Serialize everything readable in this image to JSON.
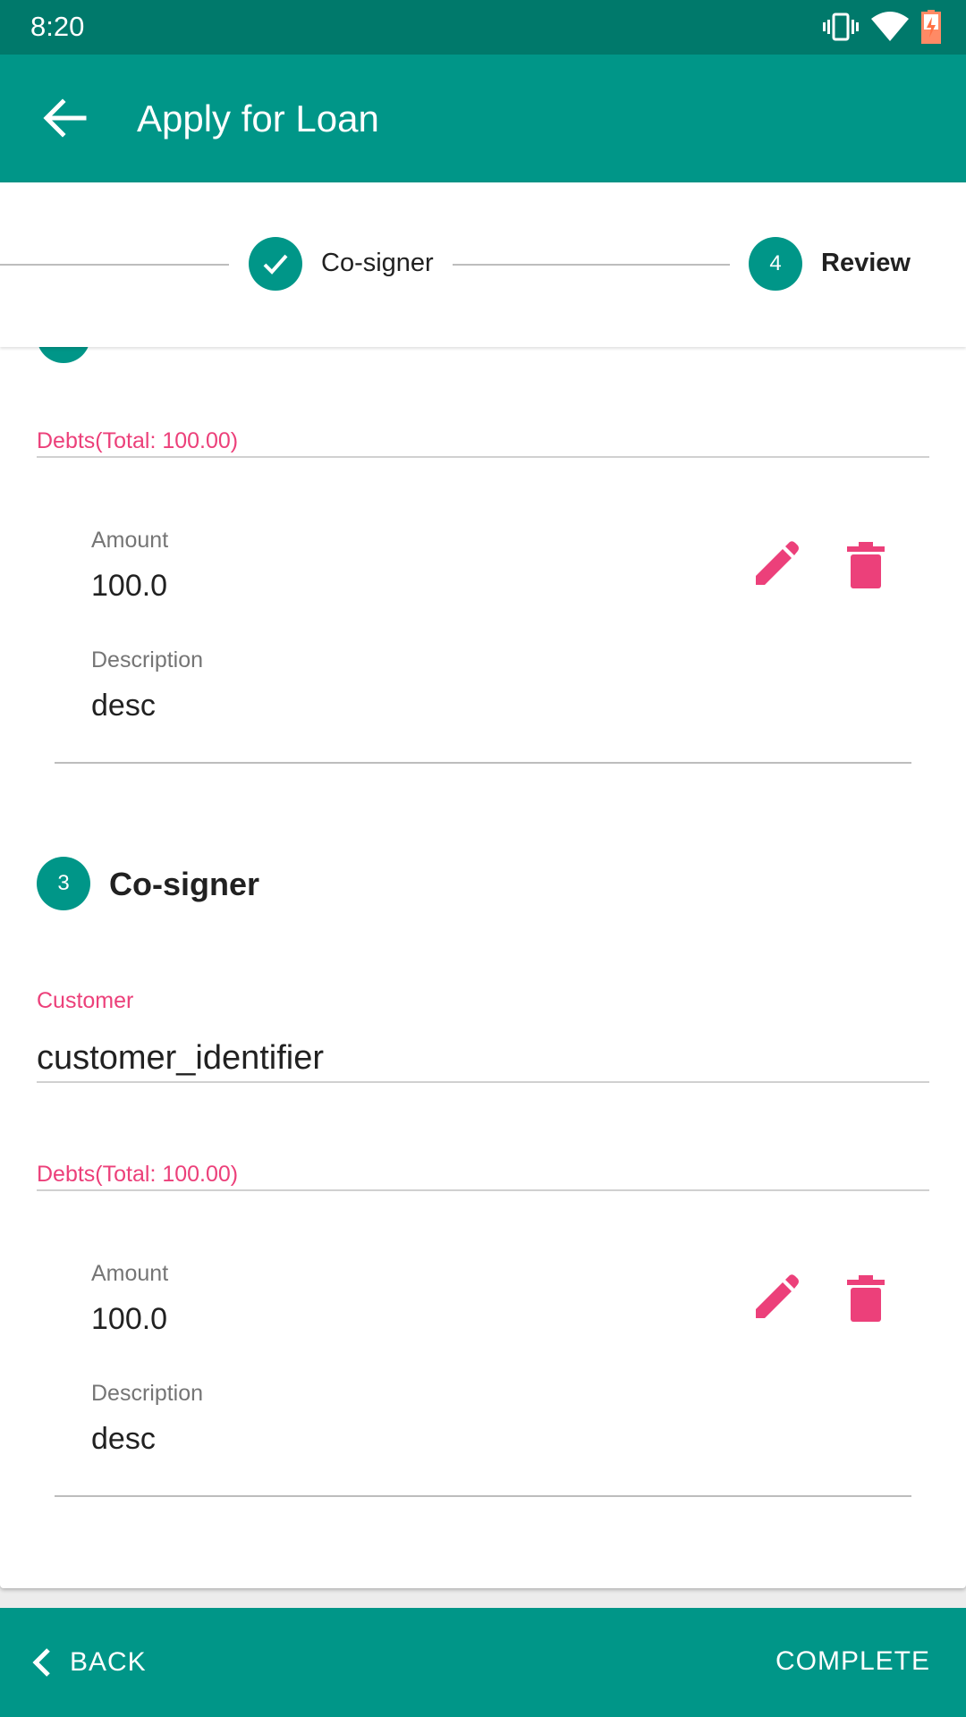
{
  "status_bar": {
    "time": "8:20"
  },
  "app_bar": {
    "title": "Apply for Loan"
  },
  "stepper": {
    "steps": [
      {
        "label": "Co-signer",
        "state": "completed"
      },
      {
        "label": "Review",
        "number": "4",
        "state": "active"
      }
    ]
  },
  "sections": {
    "debts_1": {
      "label": "Debts(Total: 100.00)",
      "amount_label": "Amount",
      "amount_value": "100.0",
      "description_label": "Description",
      "description_value": "desc"
    },
    "cosigner": {
      "number": "3",
      "title": "Co-signer",
      "customer_label": "Customer",
      "customer_value": "customer_identifier"
    },
    "debts_2": {
      "label": "Debts(Total: 100.00)",
      "amount_label": "Amount",
      "amount_value": "100.0",
      "description_label": "Description",
      "description_value": "desc"
    }
  },
  "bottom_bar": {
    "back_label": "BACK",
    "complete_label": "COMPLETE"
  },
  "colors": {
    "primary": "#009688",
    "primary_dark": "#00796b",
    "accent": "#ec407a"
  },
  "icons": [
    "vibrate-icon",
    "wifi-icon",
    "battery-charging-icon",
    "arrow-back-icon",
    "check-icon",
    "edit-icon",
    "delete-icon",
    "chevron-left-icon"
  ]
}
